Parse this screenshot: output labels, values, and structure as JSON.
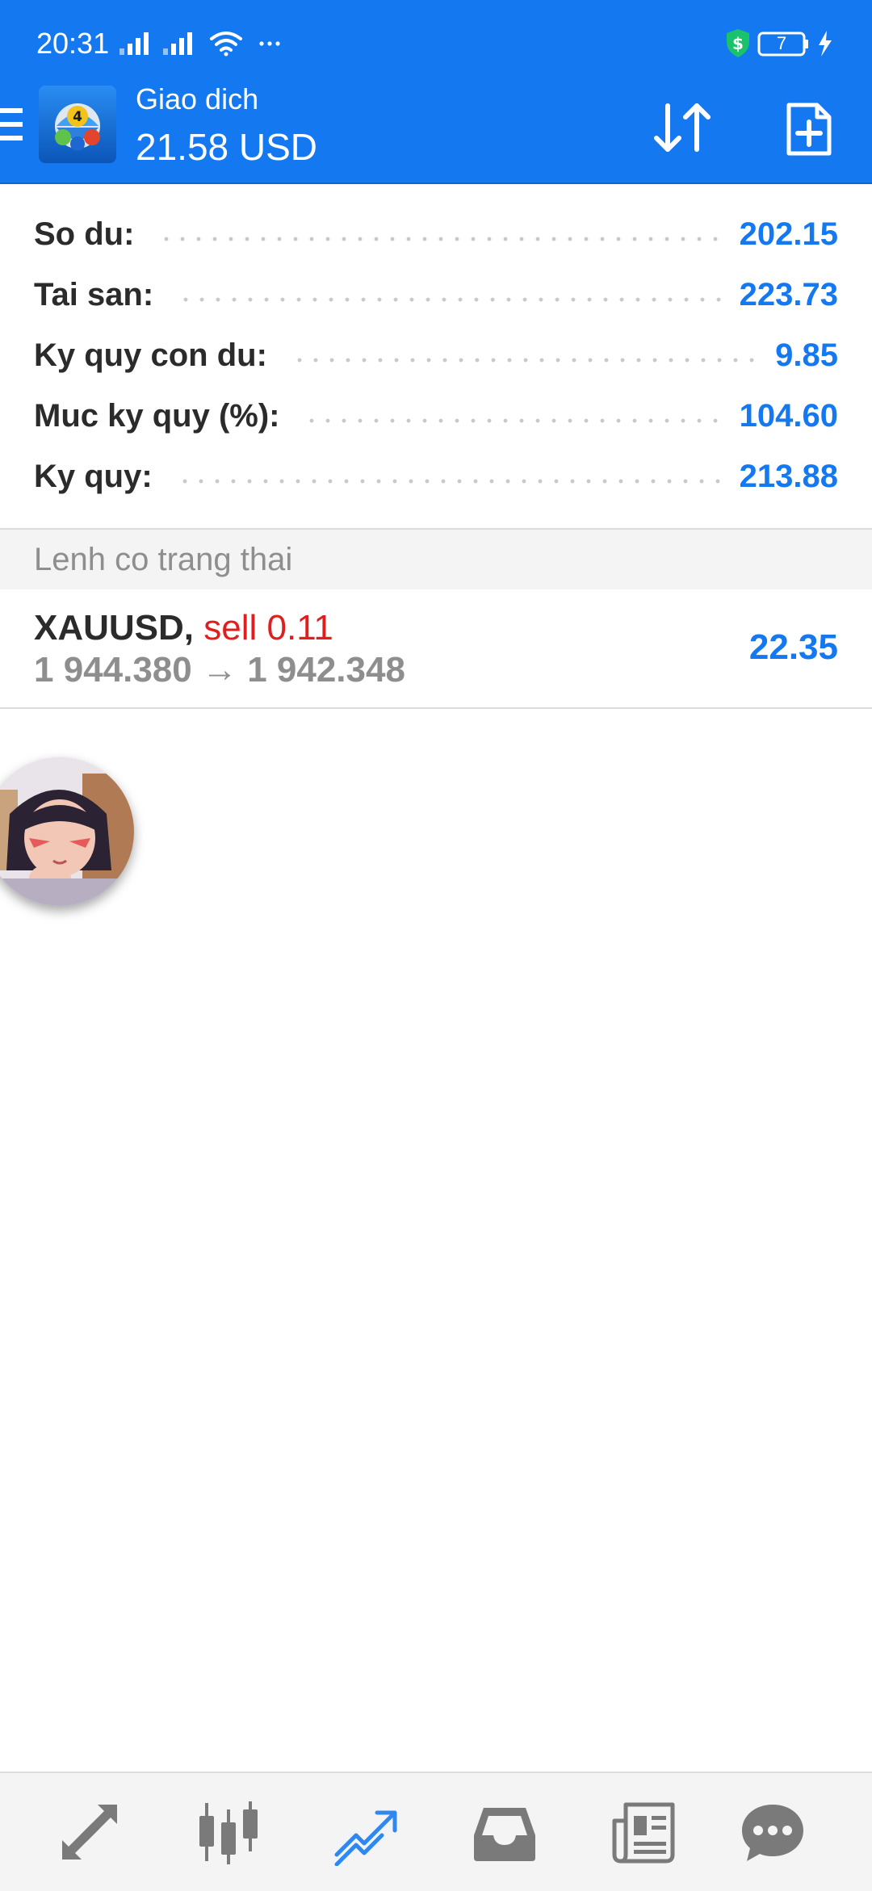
{
  "status_bar": {
    "time": "20:31",
    "battery_level": "7",
    "icons": [
      "signal-icon",
      "signal-icon",
      "wifi-icon",
      "more-dots-icon",
      "shield-dollar-icon",
      "battery-icon",
      "charging-icon"
    ]
  },
  "header": {
    "title": "Giao dich",
    "balance": "21.58 USD",
    "accent_color": "#1478f0"
  },
  "summary": {
    "rows": [
      {
        "label": "So du:",
        "value": "202.15"
      },
      {
        "label": "Tai san:",
        "value": "223.73"
      },
      {
        "label": "Ky quy con du:",
        "value": "9.85"
      },
      {
        "label": "Muc ky quy (%):",
        "value": "104.60"
      },
      {
        "label": "Ky quy:",
        "value": "213.88"
      }
    ]
  },
  "positions": {
    "section_title": "Lenh co trang thai",
    "items": [
      {
        "symbol": "XAUUSD",
        "separator": ",",
        "type": "sell 0.11",
        "prices": "1 944.380 → 1 942.348",
        "profit": "22.35"
      }
    ]
  },
  "bottom_nav": {
    "items": [
      {
        "icon": "quotes-arrows-icon",
        "active": false
      },
      {
        "icon": "candlestick-chart-icon",
        "active": false
      },
      {
        "icon": "trade-trend-icon",
        "active": true
      },
      {
        "icon": "history-inbox-icon",
        "active": false
      },
      {
        "icon": "news-icon",
        "active": false
      },
      {
        "icon": "chat-bubble-icon",
        "active": false
      }
    ],
    "active_color": "#2f88ef",
    "inactive_color": "#7a7a7a"
  }
}
